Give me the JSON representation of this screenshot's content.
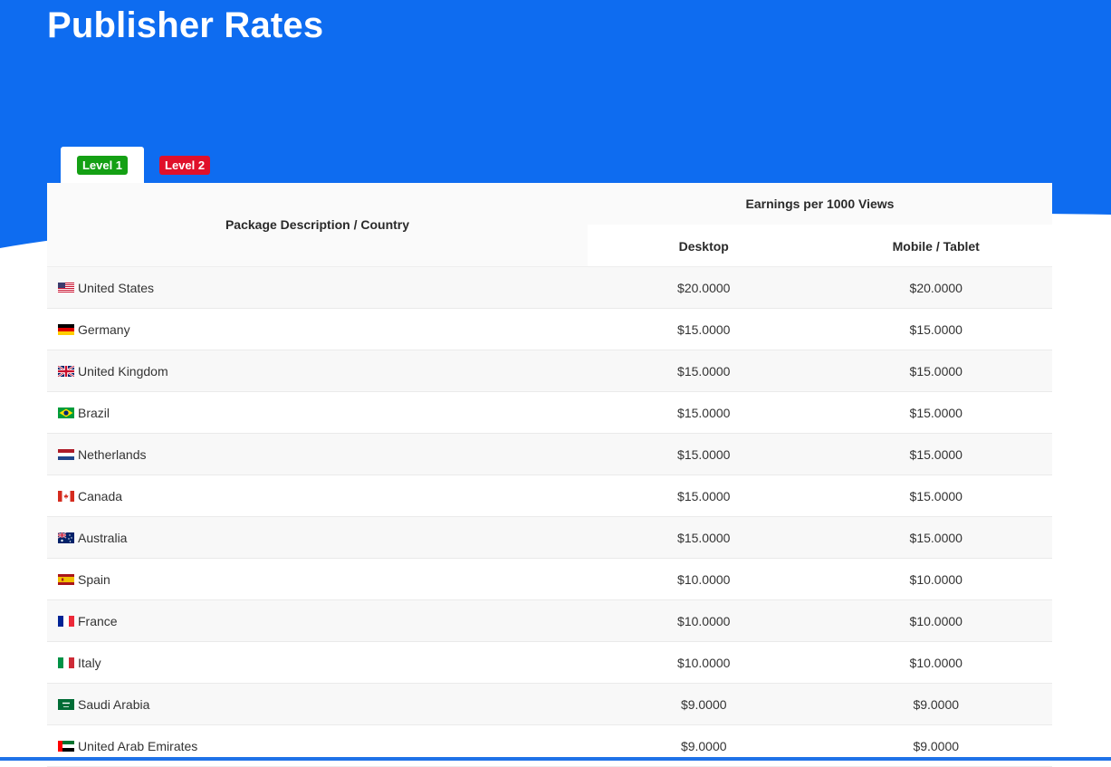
{
  "header": {
    "title": "Publisher Rates"
  },
  "tabs": [
    {
      "label": "Level 1",
      "active": true,
      "color": "#14a014"
    },
    {
      "label": "Level 2",
      "active": false,
      "color": "#e0102a"
    }
  ],
  "colors": {
    "hero": "#0e6cf0",
    "row_alt": "#f8f8f8"
  },
  "table": {
    "col_description": "Package Description / Country",
    "col_group": "Earnings per 1000 Views",
    "col_desktop": "Desktop",
    "col_mobile": "Mobile / Tablet",
    "rows": [
      {
        "flag": "us-flag-icon",
        "country": "United States",
        "desktop": "$20.0000",
        "mobile": "$20.0000"
      },
      {
        "flag": "de-flag-icon",
        "country": "Germany",
        "desktop": "$15.0000",
        "mobile": "$15.0000"
      },
      {
        "flag": "gb-flag-icon",
        "country": "United Kingdom",
        "desktop": "$15.0000",
        "mobile": "$15.0000"
      },
      {
        "flag": "br-flag-icon",
        "country": "Brazil",
        "desktop": "$15.0000",
        "mobile": "$15.0000"
      },
      {
        "flag": "nl-flag-icon",
        "country": "Netherlands",
        "desktop": "$15.0000",
        "mobile": "$15.0000"
      },
      {
        "flag": "ca-flag-icon",
        "country": "Canada",
        "desktop": "$15.0000",
        "mobile": "$15.0000"
      },
      {
        "flag": "au-flag-icon",
        "country": "Australia",
        "desktop": "$15.0000",
        "mobile": "$15.0000"
      },
      {
        "flag": "es-flag-icon",
        "country": "Spain",
        "desktop": "$10.0000",
        "mobile": "$10.0000"
      },
      {
        "flag": "fr-flag-icon",
        "country": "France",
        "desktop": "$10.0000",
        "mobile": "$10.0000"
      },
      {
        "flag": "it-flag-icon",
        "country": "Italy",
        "desktop": "$10.0000",
        "mobile": "$10.0000"
      },
      {
        "flag": "sa-flag-icon",
        "country": "Saudi Arabia",
        "desktop": "$9.0000",
        "mobile": "$9.0000"
      },
      {
        "flag": "ae-flag-icon",
        "country": "United Arab Emirates",
        "desktop": "$9.0000",
        "mobile": "$9.0000"
      }
    ]
  }
}
